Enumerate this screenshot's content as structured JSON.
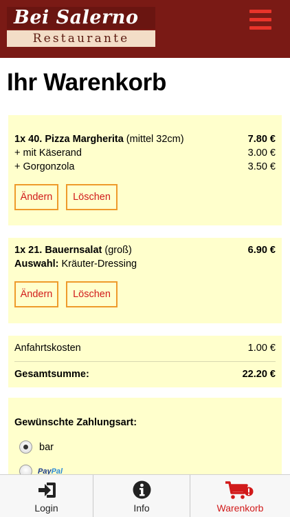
{
  "header": {
    "logo_top": "Bei Salerno",
    "logo_bottom": "Restaurante",
    "menu_icon": "hamburger-menu-icon"
  },
  "page_title": "Ihr Warenkorb",
  "items": [
    {
      "title": "1x 40. Pizza Margherita",
      "variant": "(mittel 32cm)",
      "price": "7.80 €",
      "extras": [
        {
          "label": "+ mit Käserand",
          "price": "3.00 €"
        },
        {
          "label": "+ Gorgonzola",
          "price": "3.50 €"
        }
      ],
      "edit_label": "Ändern",
      "delete_label": "Löschen"
    },
    {
      "title": "1x 21. Bauernsalat",
      "variant": "(groß)",
      "price": "6.90 €",
      "choice_label": "Auswahl:",
      "choice_value": "Kräuter-Dressing",
      "edit_label": "Ändern",
      "delete_label": "Löschen"
    }
  ],
  "summary": {
    "delivery_label": "Anfahrtskosten",
    "delivery_value": "1.00 €",
    "total_label": "Gesamtsumme:",
    "total_value": "22.20 €"
  },
  "payment": {
    "title": "Gewünschte Zahlungsart:",
    "options": [
      {
        "label": "bar",
        "selected": true
      },
      {
        "label_pay": "Pay",
        "label_pal": "Pal",
        "selected": false
      }
    ]
  },
  "tabbar": {
    "tabs": [
      {
        "label": "Login",
        "icon": "login-icon",
        "active": false
      },
      {
        "label": "Info",
        "icon": "info-icon",
        "active": false
      },
      {
        "label": "Warenkorb",
        "icon": "cart-icon",
        "active": true
      }
    ]
  },
  "colors": {
    "header_bg": "#7a1a15",
    "card_bg": "#ffffcc",
    "button_border": "#ee9a2a",
    "accent_red": "#d11a1a"
  }
}
